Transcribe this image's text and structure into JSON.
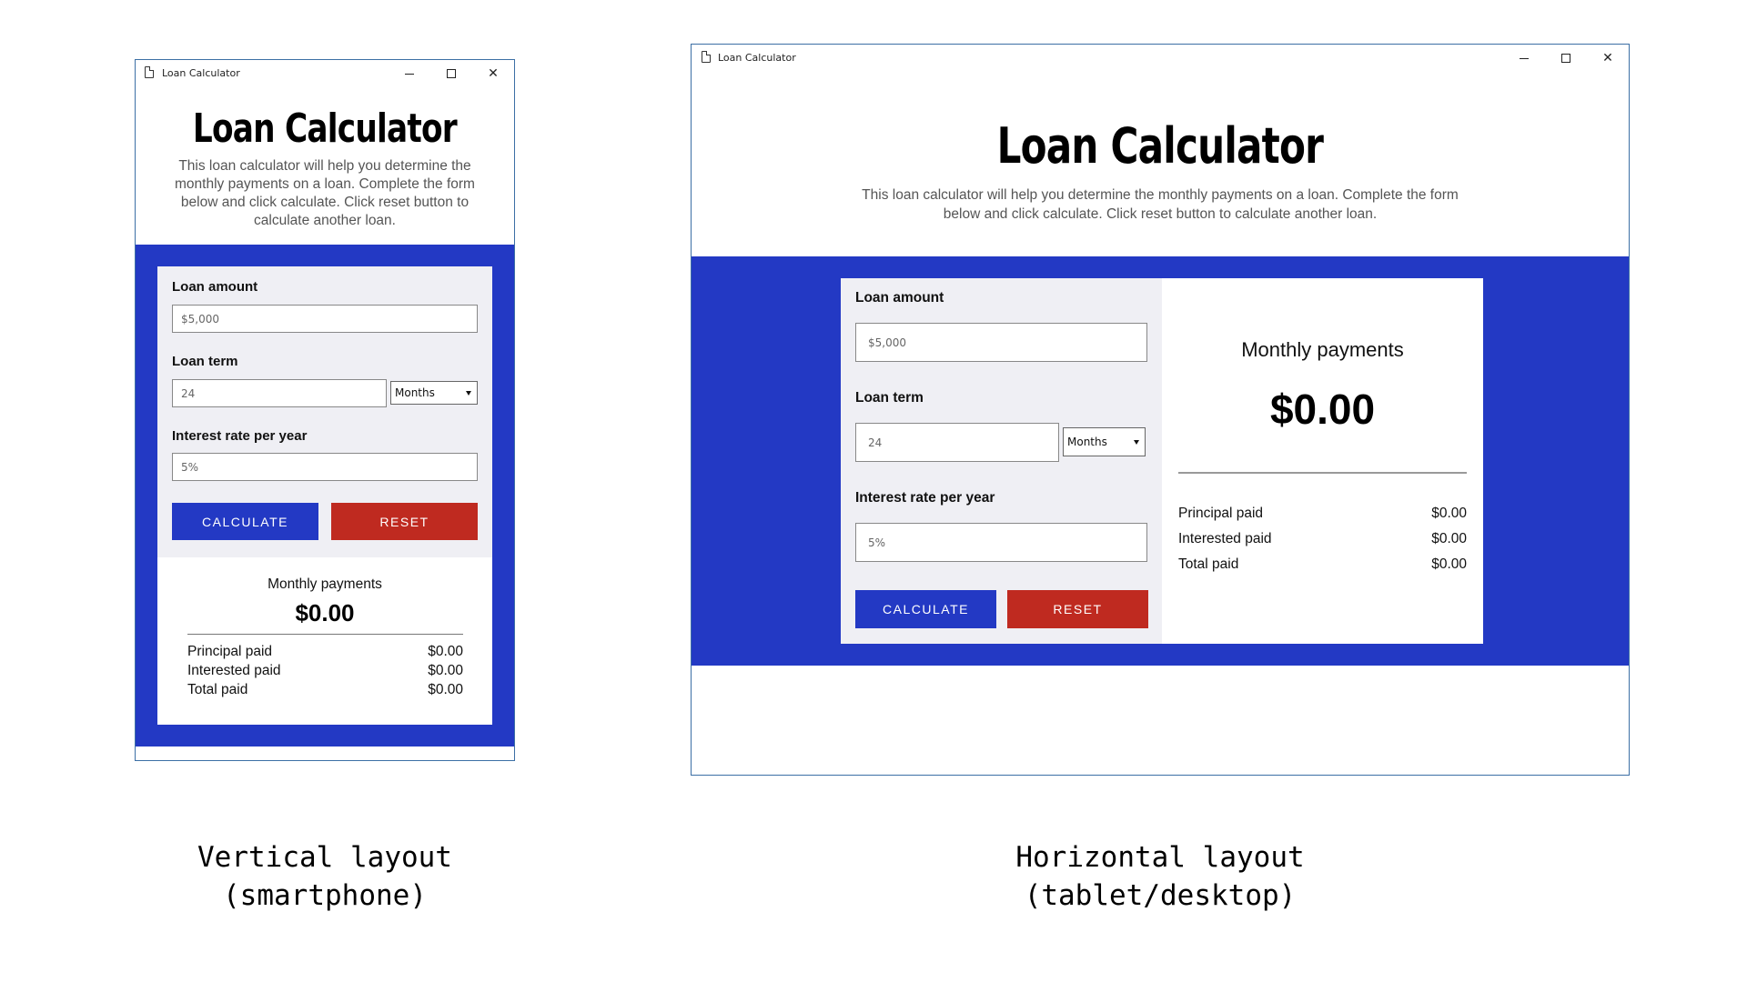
{
  "window": {
    "title": "Loan Calculator"
  },
  "app": {
    "title": "Loan Calculator",
    "description": "This loan calculator will help you determine the monthly payments on a loan. Complete the form below and click calculate. Click reset button to calculate another loan."
  },
  "form": {
    "loan_amount_label": "Loan amount",
    "loan_amount_placeholder": "$5,000",
    "loan_term_label": "Loan term",
    "loan_term_placeholder": "24",
    "term_unit_selected": "Months",
    "interest_label": "Interest rate per year",
    "interest_placeholder": "5%",
    "calculate_label": "CALCULATE",
    "reset_label": "RESET"
  },
  "results": {
    "monthly_label": "Monthly payments",
    "monthly_value": "$0.00",
    "rows": [
      {
        "label": "Principal paid",
        "value": "$0.00"
      },
      {
        "label": "Interested paid",
        "value": "$0.00"
      },
      {
        "label": "Total paid",
        "value": "$0.00"
      }
    ]
  },
  "captions": {
    "vertical_line1": "Vertical layout",
    "vertical_line2": "(smartphone)",
    "horizontal_line1": "Horizontal layout",
    "horizontal_line2": "(tablet/desktop)"
  },
  "colors": {
    "band_blue": "#2339c4",
    "calculate_button": "#2339c4",
    "reset_button": "#bf2a20",
    "form_panel": "#efeff4"
  },
  "icons": {
    "document": "document-icon",
    "minimize": "minimize-icon",
    "maximize": "maximize-icon",
    "close": "close-icon",
    "dropdown": "chevron-down-icon"
  }
}
